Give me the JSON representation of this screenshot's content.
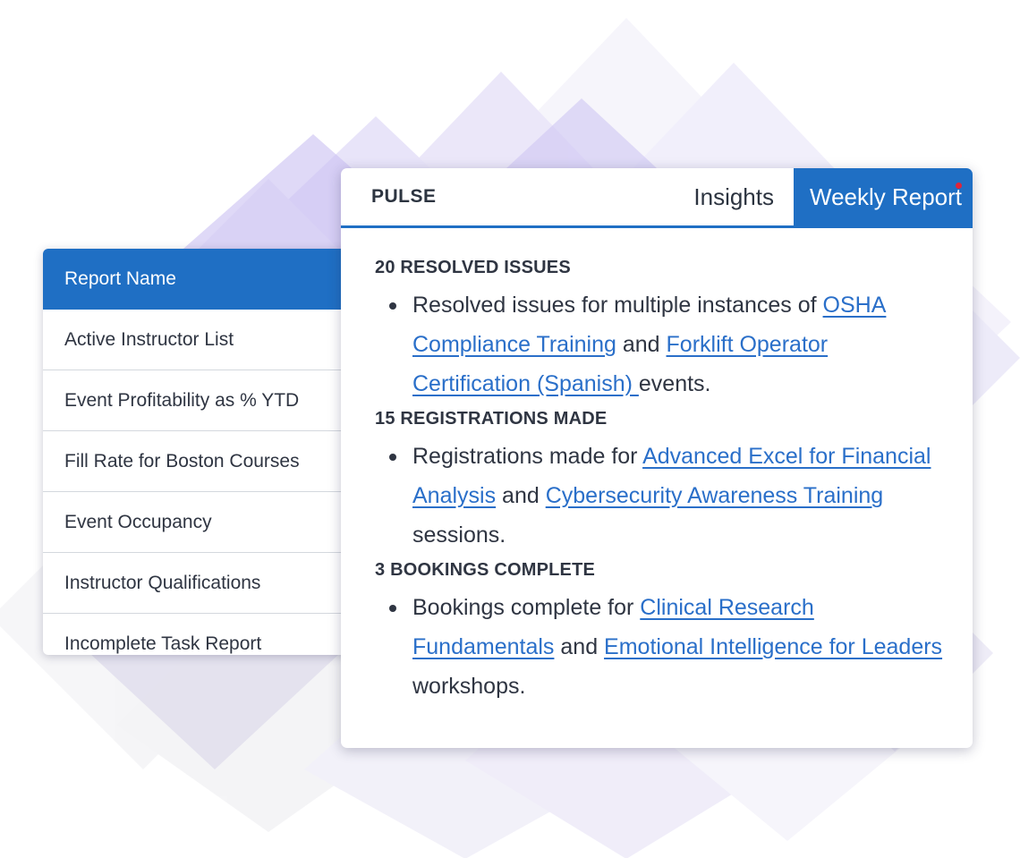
{
  "report_list": {
    "header": "Report Name",
    "rows": [
      "Active Instructor List",
      "Event Profitability as % YTD",
      "Fill Rate for Boston Courses",
      "Event Occupancy",
      "Instructor Qualifications",
      "Incomplete Task Report"
    ]
  },
  "pulse": {
    "title": "PULSE",
    "tabs": {
      "insights": "Insights",
      "weekly_report": "Weekly Report"
    },
    "sections": [
      {
        "heading": "20 RESOLVED ISSUES",
        "text_1": "Resolved issues for multiple instances of ",
        "link_1": "OSHA Compliance Training",
        "text_2": " and ",
        "link_2": "Forklift Operator Certification (Spanish) ",
        "text_3": "events."
      },
      {
        "heading": "15 REGISTRATIONS MADE",
        "text_1": "Registrations made for ",
        "link_1": "Advanced Excel for Financial Analysis",
        "text_2": " and ",
        "link_2": "Cybersecurity Awareness Training",
        "text_3": " sessions."
      },
      {
        "heading": "3 BOOKINGS COMPLETE",
        "text_1": "Bookings complete for ",
        "link_1": "Clinical Research Fundamentals",
        "text_2": " and ",
        "link_2": "Emotional Intelligence for Leaders",
        "text_3": " workshops."
      }
    ]
  },
  "colors": {
    "primary_blue": "#1f6fc4",
    "link_blue": "#2a6fc9",
    "notification_red": "#e0243a",
    "decor_lavender": "#c9c0f2"
  }
}
